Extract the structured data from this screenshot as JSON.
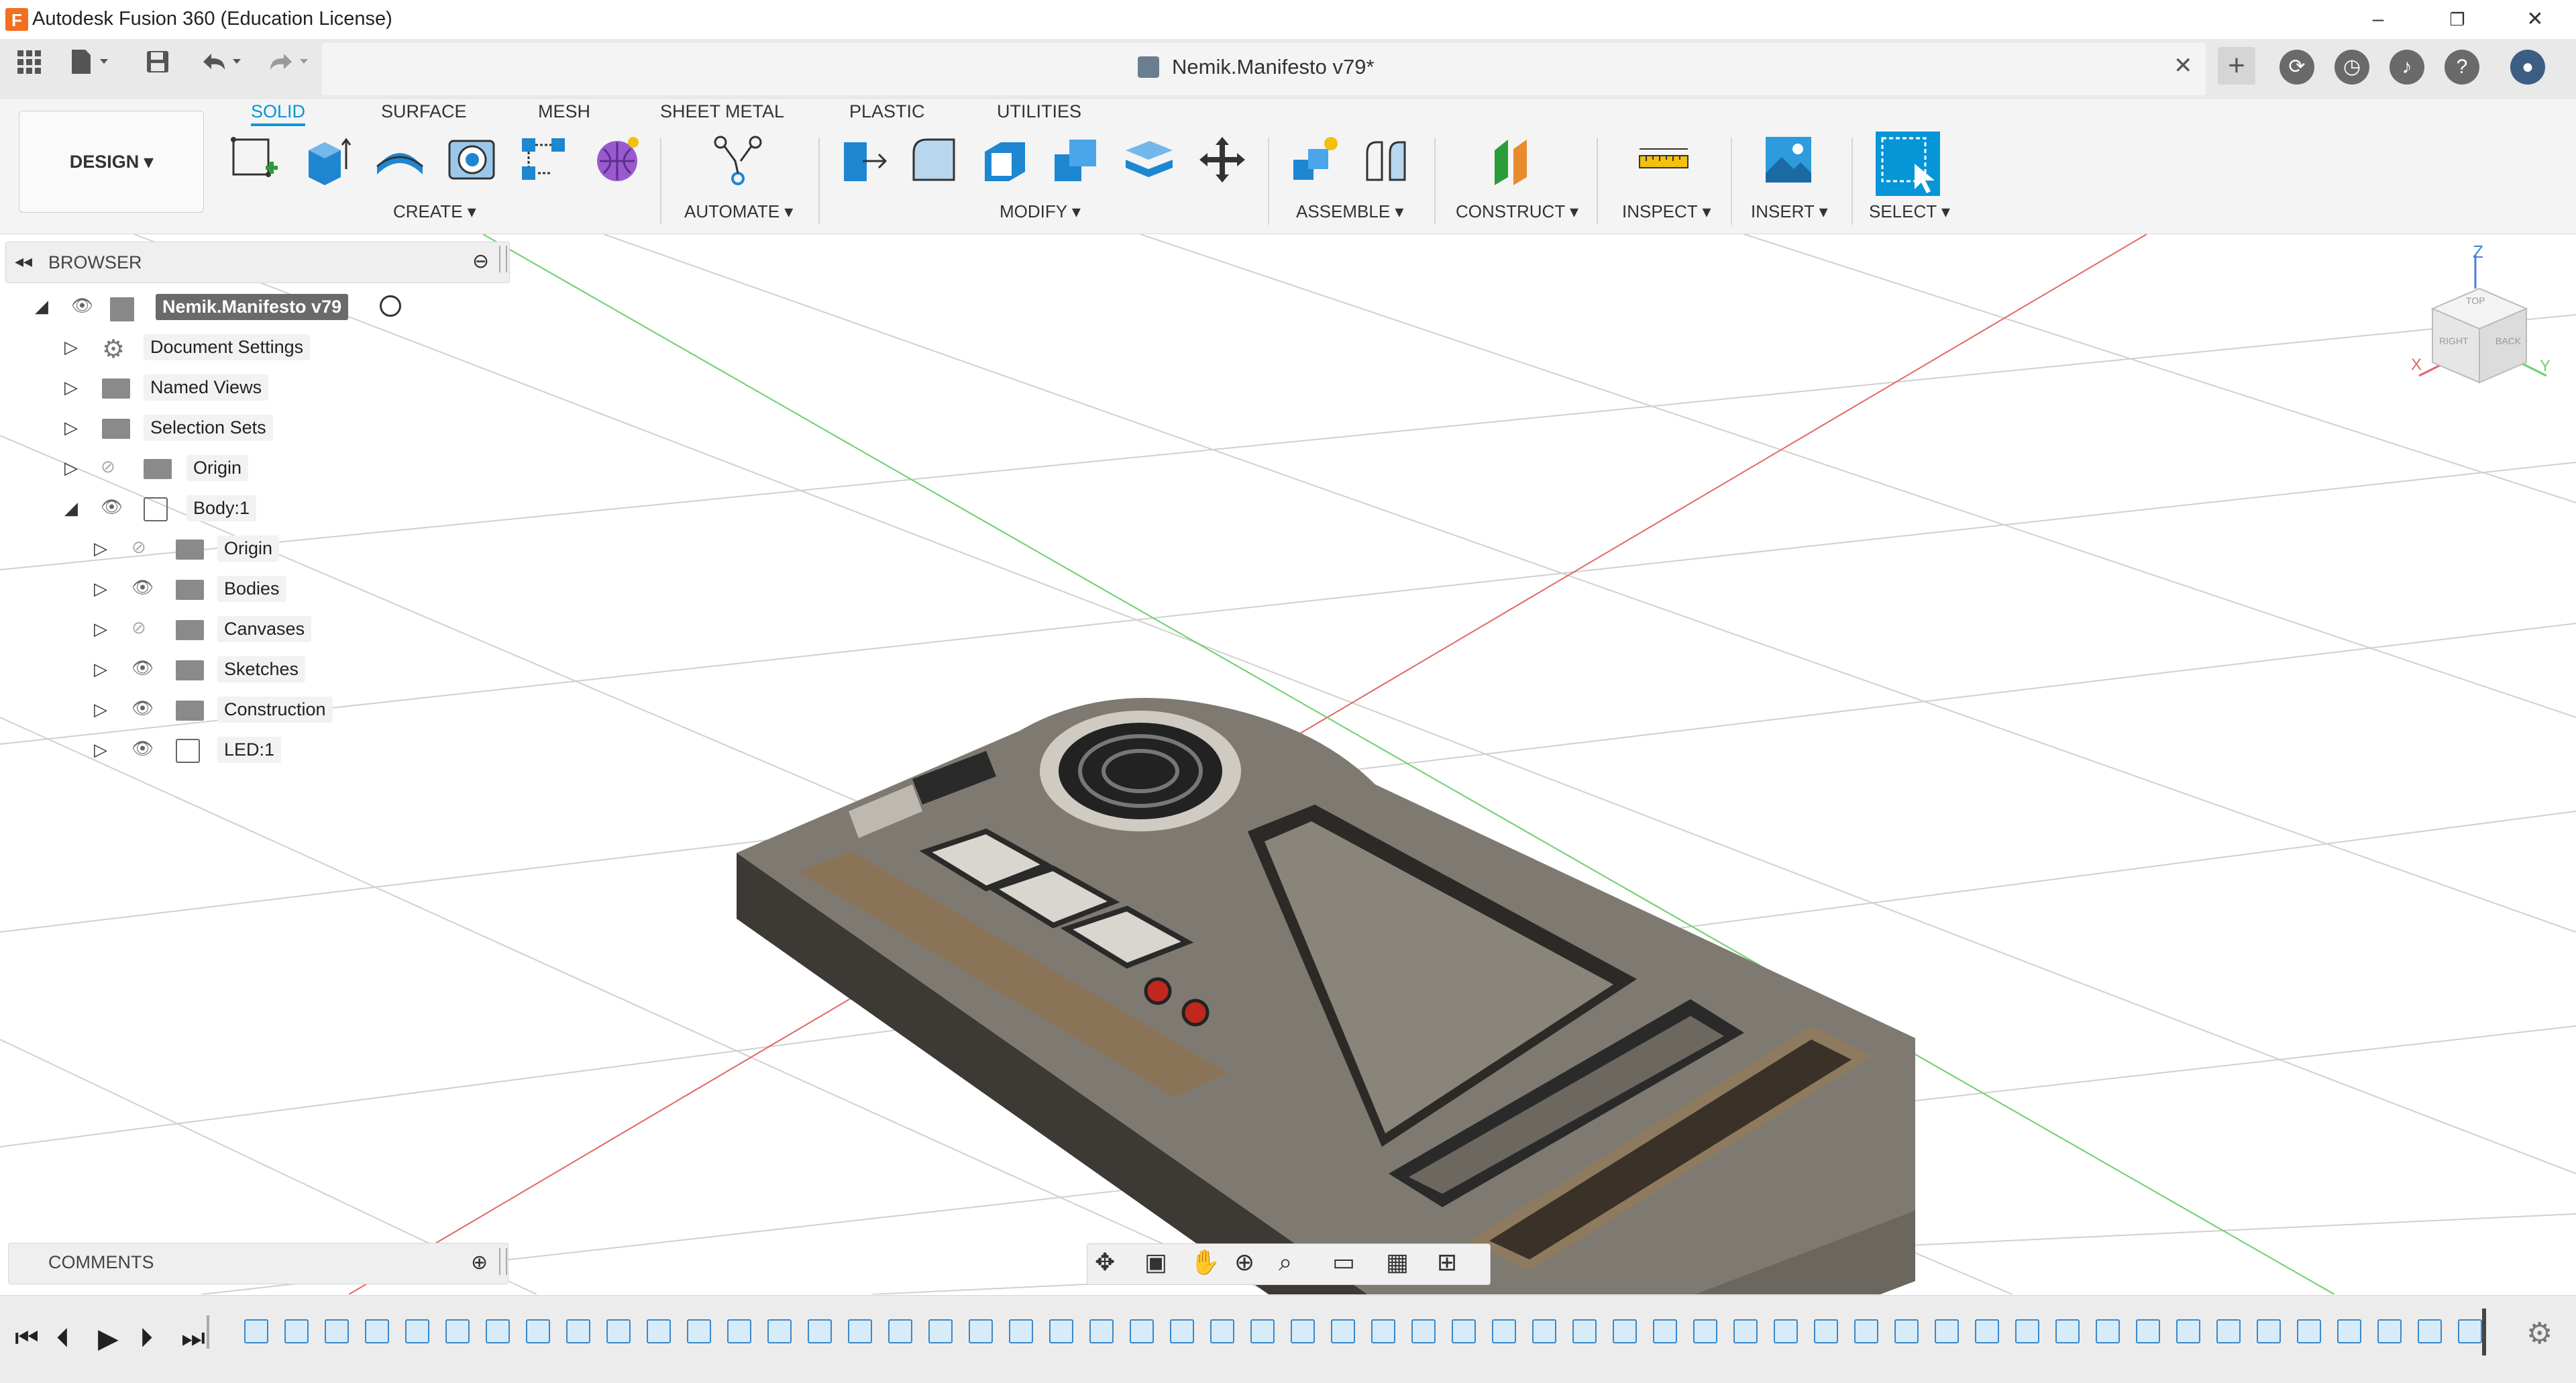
{
  "window": {
    "title": "Autodesk Fusion 360 (Education License)",
    "minimize": "–",
    "restore": "❐",
    "close": "✕"
  },
  "quickbar": {
    "document_title": "Nemik.Manifesto v79*",
    "close_tab": "✕"
  },
  "ribbon": {
    "workspace": "DESIGN ▾",
    "tabs": [
      "SOLID",
      "SURFACE",
      "MESH",
      "SHEET METAL",
      "PLASTIC",
      "UTILITIES"
    ],
    "active_tab": "SOLID",
    "groups": [
      "CREATE ▾",
      "AUTOMATE ▾",
      "MODIFY ▾",
      "ASSEMBLE ▾",
      "CONSTRUCT ▾",
      "INSPECT ▾",
      "INSERT ▾",
      "SELECT ▾"
    ]
  },
  "browser": {
    "title": "BROWSER",
    "root": "Nemik.Manifesto v79",
    "items": [
      {
        "label": "Document Settings"
      },
      {
        "label": "Named Views"
      },
      {
        "label": "Selection Sets"
      },
      {
        "label": "Origin"
      },
      {
        "label": "Body:1"
      },
      {
        "label": "Origin"
      },
      {
        "label": "Bodies"
      },
      {
        "label": "Canvases"
      },
      {
        "label": "Sketches"
      },
      {
        "label": "Construction"
      },
      {
        "label": "LED:1"
      }
    ]
  },
  "comments": {
    "title": "COMMENTS"
  },
  "viewcube": {
    "z": "Z",
    "x": "X",
    "y": "Y",
    "top": "TOP",
    "right": "RIGHT",
    "back": "BACK"
  },
  "colors": {
    "accent": "#0696d7",
    "select": "#0696d7",
    "grid": "#c8c8c8",
    "x_axis": "#e46464",
    "y_axis": "#6ccf6c"
  }
}
